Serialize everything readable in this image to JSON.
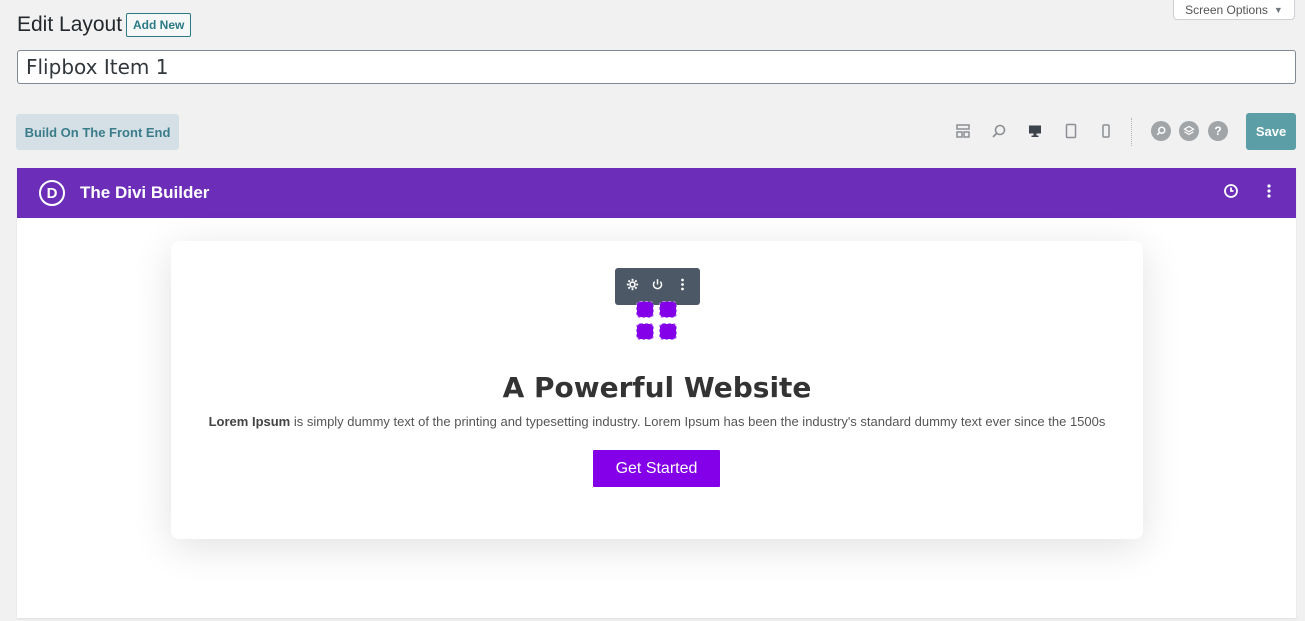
{
  "screen_options": {
    "label": "Screen Options",
    "arrow": "▼"
  },
  "header": {
    "title": "Edit Layout",
    "add_new_label": "Add New"
  },
  "title_field": {
    "value": "Flipbox Item 1"
  },
  "toolbar": {
    "front_end_label": "Build On The Front End",
    "view_icons": [
      "wireframe-icon",
      "zoom-icon",
      "desktop-icon",
      "tablet-icon",
      "phone-icon"
    ],
    "round_icons": [
      "search-icon",
      "layers-icon",
      "help-icon"
    ],
    "help_glyph": "?",
    "save_label": "Save"
  },
  "builder": {
    "logo_letter": "D",
    "title": "The Divi Builder",
    "header_color": "#6c2eb9"
  },
  "card": {
    "heading": "A Powerful Website",
    "text_bold": "Lorem Ipsum",
    "text_rest": " is simply dummy text of the printing and typesetting industry. Lorem Ipsum has been the industry's standard dummy text ever since the 1500s",
    "button_label": "Get Started",
    "accent_color": "#8300e9"
  }
}
